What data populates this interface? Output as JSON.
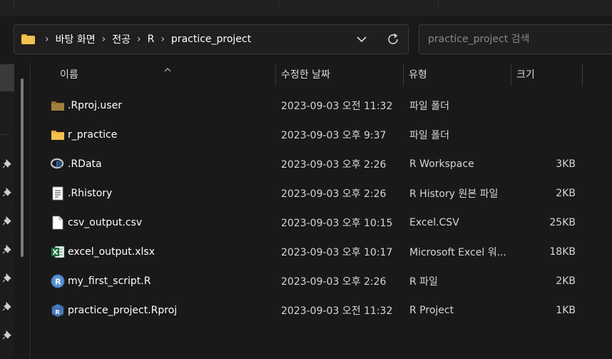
{
  "breadcrumb": [
    "바탕 화면",
    "전공",
    "R",
    "practice_project"
  ],
  "search": {
    "placeholder": "practice_project 검색"
  },
  "columns": {
    "name": "이름",
    "modified": "수정한 날짜",
    "type": "유형",
    "size": "크기"
  },
  "files": [
    {
      "name": ".Rproj.user",
      "modified": "2023-09-03 오전 11:32",
      "type": "파일 폴더",
      "size": "",
      "icon": "folder-dark-icon"
    },
    {
      "name": "r_practice",
      "modified": "2023-09-03 오후 9:37",
      "type": "파일 폴더",
      "size": "",
      "icon": "folder-icon"
    },
    {
      "name": ".RData",
      "modified": "2023-09-03 오후 2:26",
      "type": "R Workspace",
      "size": "3KB",
      "icon": "r-workspace-icon"
    },
    {
      "name": ".Rhistory",
      "modified": "2023-09-03 오후 2:26",
      "type": "R History 원본 파일",
      "size": "2KB",
      "icon": "text-file-icon"
    },
    {
      "name": "csv_output.csv",
      "modified": "2023-09-03 오후 10:15",
      "type": "Excel.CSV",
      "size": "25KB",
      "icon": "blank-file-icon"
    },
    {
      "name": "excel_output.xlsx",
      "modified": "2023-09-03 오후 10:17",
      "type": "Microsoft Excel 워...",
      "size": "18KB",
      "icon": "excel-icon"
    },
    {
      "name": "my_first_script.R",
      "modified": "2023-09-03 오후 2:26",
      "type": "R 파일",
      "size": "2KB",
      "icon": "r-script-icon"
    },
    {
      "name": "practice_project.Rproj",
      "modified": "2023-09-03 오전 11:32",
      "type": "R Project",
      "size": "1KB",
      "icon": "r-project-icon"
    }
  ],
  "colors": {
    "background": "#191919",
    "folder": "#f2c14e",
    "excel": "#1d6f42",
    "r_blue": "#2d6ab3"
  }
}
